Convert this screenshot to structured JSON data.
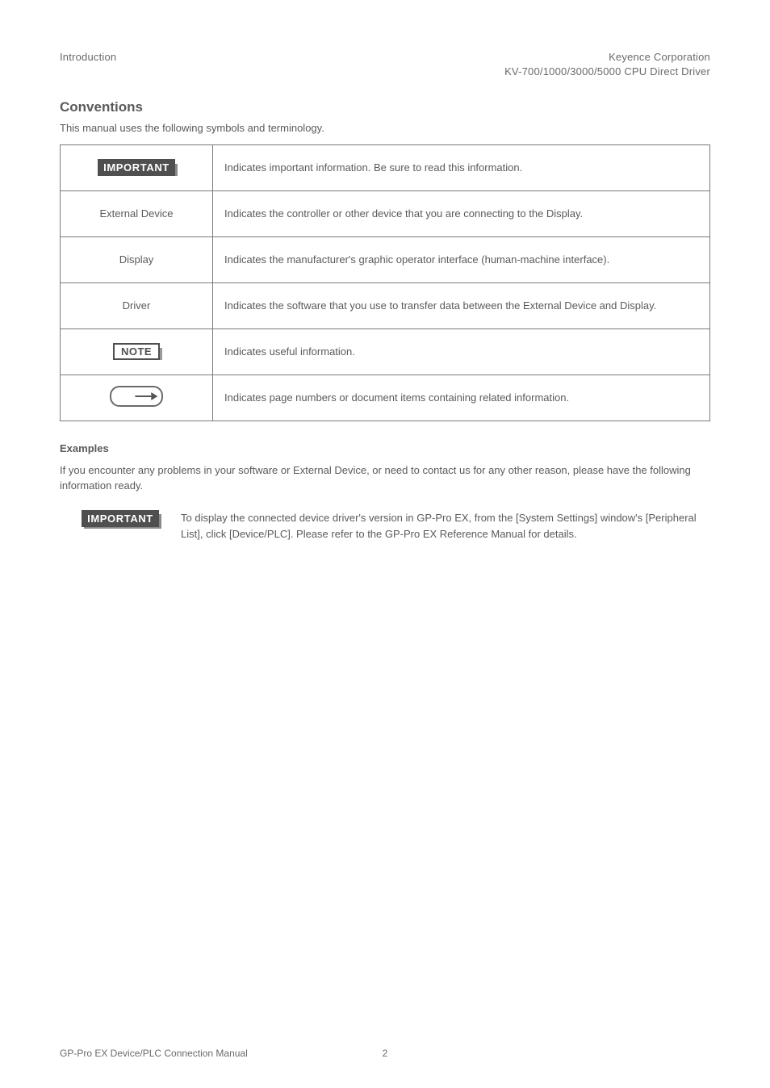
{
  "header": {
    "left_line": "Introduction",
    "right_line1": "Keyence Corporation",
    "right_line2": "KV-700/1000/3000/5000 CPU Direct Driver"
  },
  "conventions": {
    "heading": "Conventions",
    "lead": "This manual uses the following symbols and terminology.",
    "rows": [
      {
        "symbol_key": "important",
        "desc": "Indicates important information. Be sure to read this information."
      },
      {
        "symbol_key": "external_device",
        "desc": "Indicates the controller or other device that you are connecting to the Display."
      },
      {
        "symbol_key": "display",
        "desc": "Indicates the manufacturer's graphic operator interface (human-machine interface)."
      },
      {
        "symbol_key": "driver",
        "desc": "Indicates the software that you use to transfer data between the External Device and Display."
      },
      {
        "symbol_key": "note",
        "desc": "Indicates useful information."
      },
      {
        "symbol_key": "reference",
        "desc": "Indicates page numbers or document items containing related information."
      }
    ],
    "labels": {
      "external_device": "External Device",
      "display": "Display",
      "driver": "Driver"
    }
  },
  "examples": {
    "heading": "Examples",
    "body": "If you encounter any problems in your software or External Device, or need to contact us for any other reason, please have the following information ready.",
    "important_note": "To display the connected device driver's version in GP-Pro EX, from the [System Settings] window's [Peripheral List], click [Device/PLC]. Please refer to the GP-Pro EX Reference Manual for details."
  },
  "footer": {
    "left": "GP-Pro EX Device/PLC Connection Manual",
    "center": "2"
  }
}
